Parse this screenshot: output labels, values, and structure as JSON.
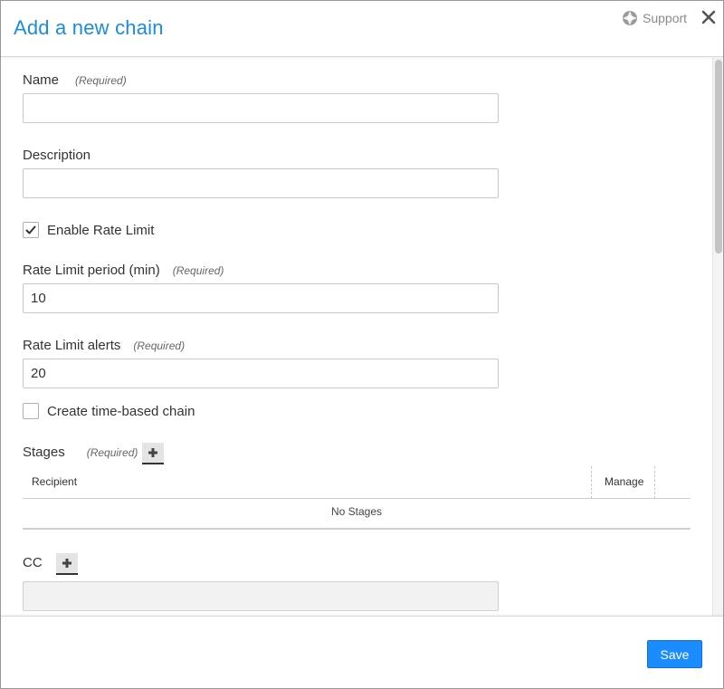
{
  "dialog": {
    "title": "Add a new chain",
    "support_label": "Support"
  },
  "form": {
    "name": {
      "label": "Name",
      "required": "(Required)",
      "value": "",
      "placeholder": ""
    },
    "description": {
      "label": "Description",
      "value": "",
      "placeholder": ""
    },
    "enable_rate_limit": {
      "label": "Enable Rate Limit",
      "checked": true
    },
    "rate_limit_period": {
      "label": "Rate Limit period (min)",
      "required": "(Required)",
      "value": "10"
    },
    "rate_limit_alerts": {
      "label": "Rate Limit alerts",
      "required": "(Required)",
      "value": "20"
    },
    "time_based": {
      "label": "Create time-based chain",
      "checked": false
    },
    "stages": {
      "label": "Stages",
      "required": "(Required)",
      "columns": [
        "Recipient",
        "Manage"
      ],
      "empty_text": "No Stages"
    },
    "cc": {
      "label": "CC",
      "value": ""
    }
  },
  "footer": {
    "save_label": "Save"
  },
  "colors": {
    "accent": "#1a8cde",
    "button": "#1a8cff"
  }
}
